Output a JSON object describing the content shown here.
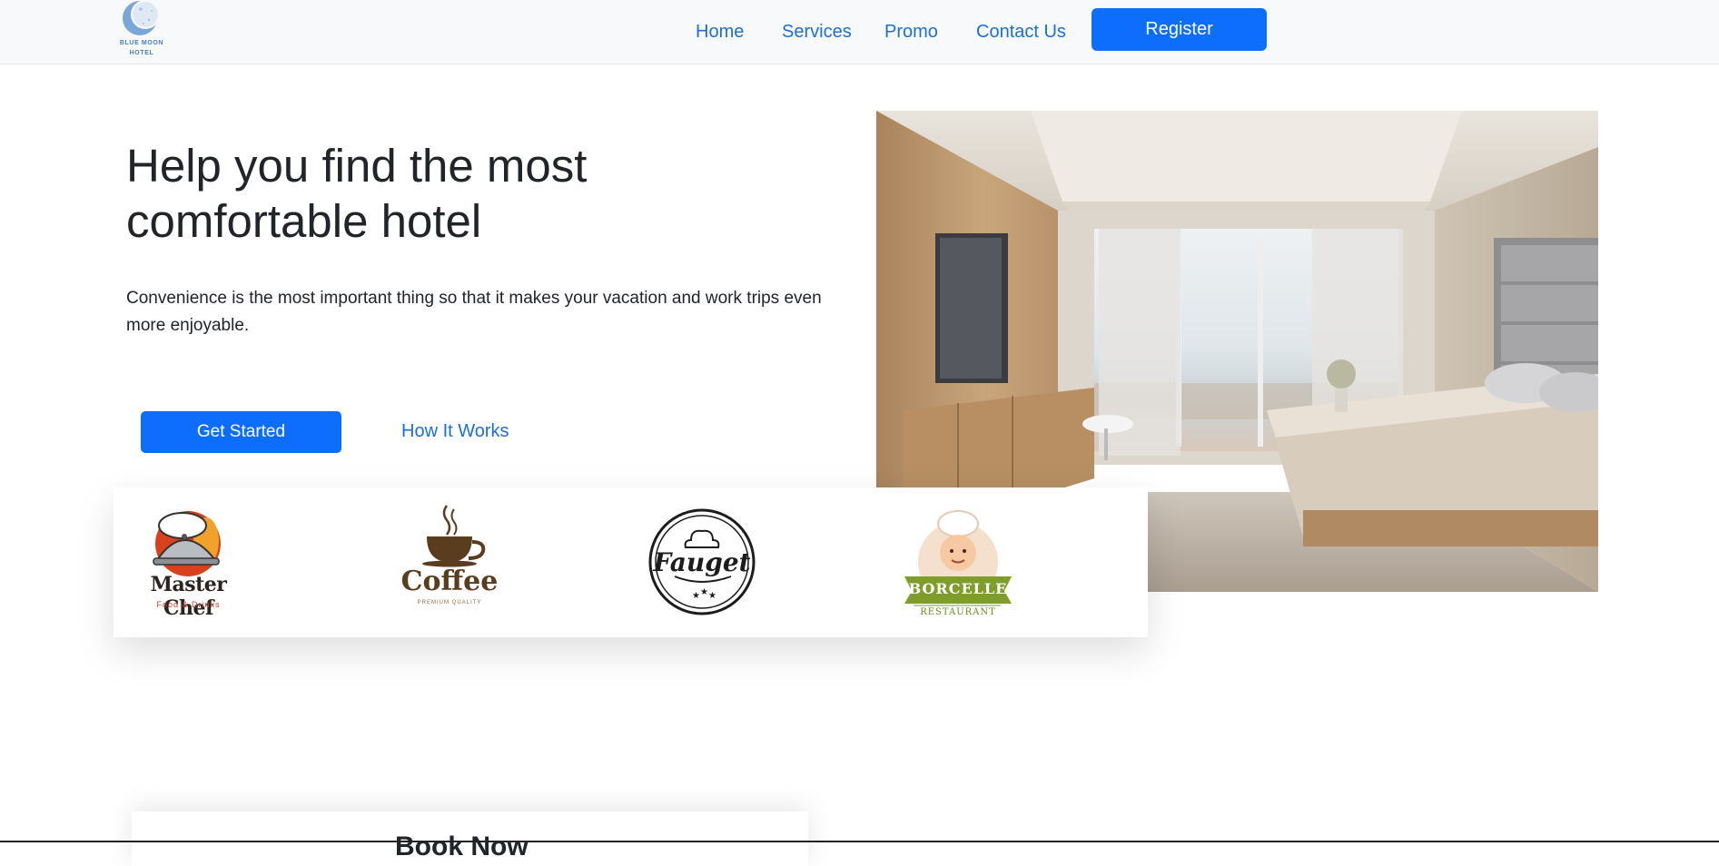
{
  "brand": {
    "line1": "BLUE MOON",
    "line2": "HOTEL"
  },
  "nav": {
    "links": [
      "Home",
      "Services",
      "Promo",
      "Contact Us"
    ],
    "register_label": "Register"
  },
  "hero": {
    "title_line1": "Help you find the most",
    "title_line2": "comfortable hotel",
    "description": "Convenience is the most important thing so that it makes your vacation and work trips even more enjoyable.",
    "primary_button": "Get Started",
    "secondary_link": "How It Works"
  },
  "partners": [
    {
      "name": "Master Chef",
      "tagline": "Food & Drinks"
    },
    {
      "name": "Coffee",
      "tagline": "PREMIUM QUALITY"
    },
    {
      "name": "Fauget",
      "tagline": ""
    },
    {
      "name": "BORCELLE",
      "tagline": "RESTAURANT"
    }
  ],
  "book_section": {
    "title": "Book Now"
  },
  "colors": {
    "primary": "#0d6efd",
    "link": "#1a6fd8",
    "navbar_bg": "#f8f9fa",
    "text": "#212529"
  }
}
